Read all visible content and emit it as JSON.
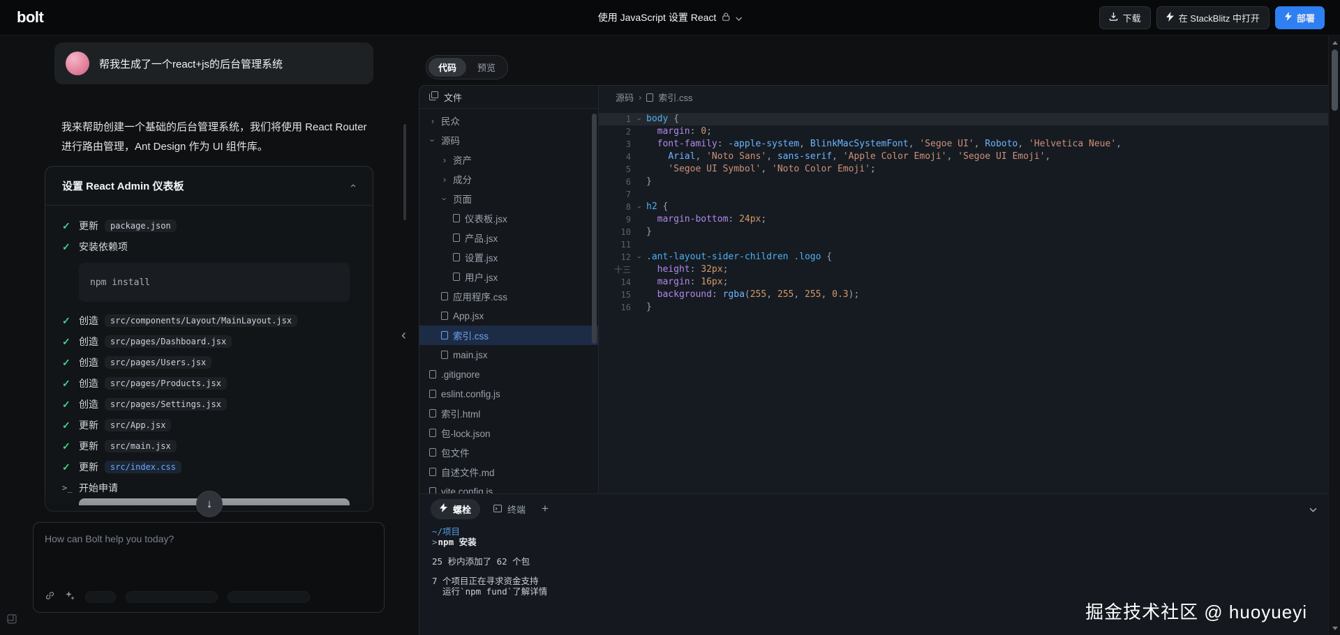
{
  "colors": {
    "accent_blue": "#2e7ff2",
    "check_green": "#3fd68f",
    "selected_file_blue": "#6fa3f0"
  },
  "topbar": {
    "logo": "bolt",
    "project_title": "使用 JavaScript 设置 React",
    "download_label": "下载",
    "open_stackblitz_label": "在 StackBlitz 中打开",
    "deploy_label": "部署"
  },
  "chat": {
    "user_message": "帮我生成了一个react+js的后台管理系统",
    "assistant_intro": "我来帮助创建一个基础的后台管理系统，我们将使用 React Router 进行路由管理，Ant Design 作为 UI 组件库。",
    "plan_card": {
      "title": "设置 React Admin 仪表板",
      "steps": [
        {
          "type": "check",
          "action": "更新",
          "target": "package.json"
        },
        {
          "type": "check",
          "action": "安装依赖项",
          "target": ""
        },
        {
          "type": "codeblock",
          "code": "npm install"
        },
        {
          "type": "check",
          "action": "创造",
          "target": "src/components/Layout/MainLayout.jsx"
        },
        {
          "type": "check",
          "action": "创造",
          "target": "src/pages/Dashboard.jsx"
        },
        {
          "type": "check",
          "action": "创造",
          "target": "src/pages/Users.jsx"
        },
        {
          "type": "check",
          "action": "创造",
          "target": "src/pages/Products.jsx"
        },
        {
          "type": "check",
          "action": "创造",
          "target": "src/pages/Settings.jsx"
        },
        {
          "type": "check",
          "action": "更新",
          "target": "src/App.jsx"
        },
        {
          "type": "check",
          "action": "更新",
          "target": "src/main.jsx"
        },
        {
          "type": "check",
          "action": "更新",
          "target": "src/index.css",
          "highlight": true
        },
        {
          "type": "terminal-step",
          "action": "开始申请"
        }
      ]
    },
    "composer": {
      "placeholder": "How can Bolt help you today?"
    }
  },
  "editor": {
    "view_tabs": [
      {
        "id": "code",
        "label": "代码",
        "active": true
      },
      {
        "id": "preview",
        "label": "预览",
        "active": false
      }
    ],
    "file_panel": {
      "title": "文件",
      "items": [
        {
          "label": "民众",
          "kind": "folder",
          "expanded": false,
          "depth": 0
        },
        {
          "label": "源码",
          "kind": "folder",
          "expanded": true,
          "depth": 0
        },
        {
          "label": "资产",
          "kind": "folder",
          "expanded": false,
          "depth": 1
        },
        {
          "label": "成分",
          "kind": "folder",
          "expanded": false,
          "depth": 1
        },
        {
          "label": "页面",
          "kind": "folder",
          "expanded": true,
          "depth": 1
        },
        {
          "label": "仪表板.jsx",
          "kind": "file",
          "depth": 2
        },
        {
          "label": "产品.jsx",
          "kind": "file",
          "depth": 2
        },
        {
          "label": "设置.jsx",
          "kind": "file",
          "depth": 2
        },
        {
          "label": "用户.jsx",
          "kind": "file",
          "depth": 2
        },
        {
          "label": "应用程序.css",
          "kind": "file",
          "depth": 1
        },
        {
          "label": "App.jsx",
          "kind": "file",
          "depth": 1
        },
        {
          "label": "索引.css",
          "kind": "file",
          "depth": 1,
          "selected": true
        },
        {
          "label": "main.jsx",
          "kind": "file",
          "depth": 1
        },
        {
          "label": ".gitignore",
          "kind": "file",
          "depth": 0
        },
        {
          "label": "eslint.config.js",
          "kind": "file",
          "depth": 0
        },
        {
          "label": "索引.html",
          "kind": "file",
          "depth": 0
        },
        {
          "label": "包-lock.json",
          "kind": "file",
          "depth": 0
        },
        {
          "label": "包文件",
          "kind": "file",
          "depth": 0
        },
        {
          "label": "自述文件.md",
          "kind": "file",
          "depth": 0
        },
        {
          "label": "vite.config.js",
          "kind": "file",
          "depth": 0
        }
      ]
    },
    "breadcrumb": {
      "root": "源码",
      "file": "索引.css"
    },
    "code": {
      "lines": [
        {
          "n": "1",
          "fold": true,
          "active": true,
          "tokens": [
            [
              "sel",
              "body"
            ],
            [
              "pun",
              " {"
            ]
          ]
        },
        {
          "n": "2",
          "tokens": [
            [
              "ws",
              "  "
            ],
            [
              "prop",
              "margin"
            ],
            [
              "pun",
              ": "
            ],
            [
              "num",
              "0"
            ],
            [
              "pun",
              ";"
            ]
          ]
        },
        {
          "n": "3",
          "tokens": [
            [
              "ws",
              "  "
            ],
            [
              "prop",
              "font-family"
            ],
            [
              "pun",
              ": "
            ],
            [
              "ident",
              "-apple-system"
            ],
            [
              "pun",
              ", "
            ],
            [
              "ident",
              "BlinkMacSystemFont"
            ],
            [
              "pun",
              ", "
            ],
            [
              "str",
              "'Segoe UI'"
            ],
            [
              "pun",
              ", "
            ],
            [
              "ident",
              "Roboto"
            ],
            [
              "pun",
              ", "
            ],
            [
              "str",
              "'Helvetica Neue'"
            ],
            [
              "pun",
              ","
            ]
          ]
        },
        {
          "n": "4",
          "tokens": [
            [
              "ws",
              "    "
            ],
            [
              "ident",
              "Arial"
            ],
            [
              "pun",
              ", "
            ],
            [
              "str",
              "'Noto Sans'"
            ],
            [
              "pun",
              ", "
            ],
            [
              "ident",
              "sans-serif"
            ],
            [
              "pun",
              ", "
            ],
            [
              "str",
              "'Apple Color Emoji'"
            ],
            [
              "pun",
              ", "
            ],
            [
              "str",
              "'Segoe UI Emoji'"
            ],
            [
              "pun",
              ","
            ]
          ]
        },
        {
          "n": "5",
          "tokens": [
            [
              "ws",
              "    "
            ],
            [
              "str",
              "'Segoe UI Symbol'"
            ],
            [
              "pun",
              ", "
            ],
            [
              "str",
              "'Noto Color Emoji'"
            ],
            [
              "pun",
              ";"
            ]
          ]
        },
        {
          "n": "6",
          "tokens": [
            [
              "pun",
              "}"
            ]
          ]
        },
        {
          "n": "7",
          "tokens": []
        },
        {
          "n": "8",
          "fold": true,
          "tokens": [
            [
              "sel",
              "h2"
            ],
            [
              "pun",
              " {"
            ]
          ]
        },
        {
          "n": "9",
          "tokens": [
            [
              "ws",
              "  "
            ],
            [
              "prop",
              "margin-bottom"
            ],
            [
              "pun",
              ": "
            ],
            [
              "num",
              "24px"
            ],
            [
              "pun",
              ";"
            ]
          ]
        },
        {
          "n": "10",
          "tokens": [
            [
              "pun",
              "}"
            ]
          ]
        },
        {
          "n": "11",
          "tokens": []
        },
        {
          "n": "12",
          "fold": true,
          "tokens": [
            [
              "sel",
              ".ant-layout-sider-children .logo"
            ],
            [
              "pun",
              " {"
            ]
          ]
        },
        {
          "n": "十三",
          "tokens": [
            [
              "ws",
              "  "
            ],
            [
              "prop",
              "height"
            ],
            [
              "pun",
              ": "
            ],
            [
              "num",
              "32px"
            ],
            [
              "pun",
              ";"
            ]
          ]
        },
        {
          "n": "14",
          "tokens": [
            [
              "ws",
              "  "
            ],
            [
              "prop",
              "margin"
            ],
            [
              "pun",
              ": "
            ],
            [
              "num",
              "16px"
            ],
            [
              "pun",
              ";"
            ]
          ]
        },
        {
          "n": "15",
          "tokens": [
            [
              "ws",
              "  "
            ],
            [
              "prop",
              "background"
            ],
            [
              "pun",
              ": "
            ],
            [
              "fn",
              "rgba"
            ],
            [
              "pun",
              "("
            ],
            [
              "num",
              "255"
            ],
            [
              "pun",
              ", "
            ],
            [
              "num",
              "255"
            ],
            [
              "pun",
              ", "
            ],
            [
              "num",
              "255"
            ],
            [
              "pun",
              ", "
            ],
            [
              "num",
              "0.3"
            ],
            [
              "pun",
              ")"
            ],
            [
              "pun",
              ";"
            ]
          ]
        },
        {
          "n": "16",
          "tokens": [
            [
              "pun",
              "}"
            ]
          ]
        }
      ]
    },
    "terminal": {
      "tabs": [
        {
          "id": "bolt",
          "label": "螺栓",
          "active": true
        },
        {
          "id": "terminal",
          "label": "终端",
          "active": false
        }
      ],
      "lines": [
        {
          "cls": "path",
          "text": "~/项目"
        },
        {
          "cls": "cmd",
          "prompt": ">",
          "text": "npm 安装"
        },
        {
          "cls": "gap"
        },
        {
          "cls": "out",
          "text": "25 秒内添加了 62 个包"
        },
        {
          "cls": "gap"
        },
        {
          "cls": "out",
          "text": "7 个项目正在寻求资金支持"
        },
        {
          "cls": "out",
          "text": "  运行`npm fund`了解详情"
        }
      ]
    }
  },
  "watermark": "掘金技术社区 @ huoyueyi"
}
